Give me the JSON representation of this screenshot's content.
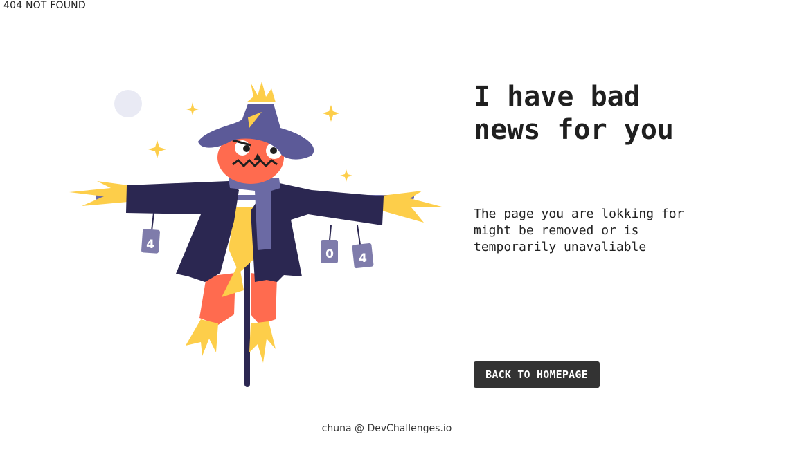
{
  "header": {
    "brand": "404 NOT FOUND"
  },
  "illustration": {
    "cans": [
      "4",
      "0",
      "4"
    ],
    "colors": {
      "coat": "#2b2751",
      "hat": "#5c5a98",
      "face": "#ff6b4f",
      "straw": "#fdce4a",
      "scarf": "#6b6aa4",
      "moon": "#e9eaf4",
      "can": "#7f7cab"
    }
  },
  "main": {
    "headline": "I have bad\nnews for you",
    "subtext": "The page you are lokking for might be removed or is temporarily unavaliable",
    "button_label": "BACK TO HOMEPAGE"
  },
  "footer": {
    "credit": "chuna @ DevChallenges.io"
  }
}
